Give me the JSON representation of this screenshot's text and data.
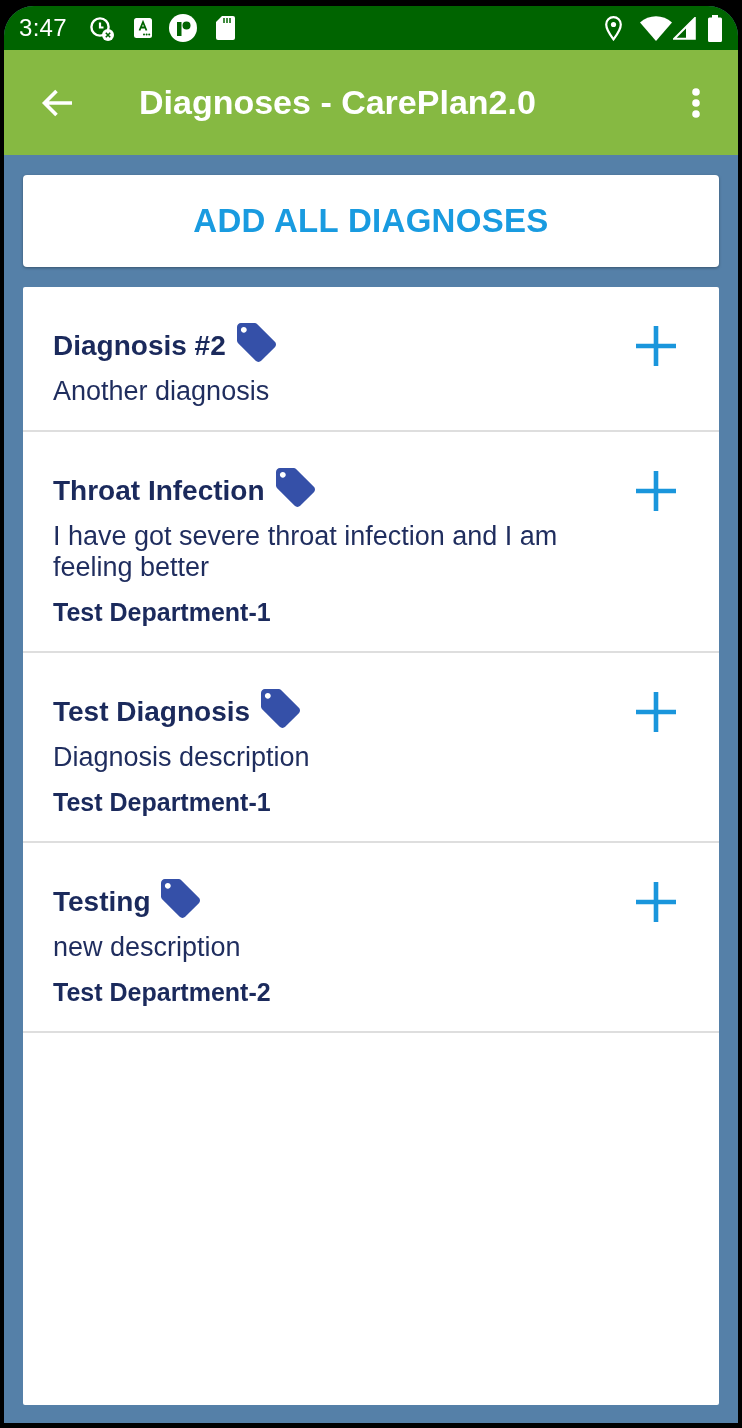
{
  "status_bar": {
    "time": "3:47"
  },
  "app_bar": {
    "title": "Diagnoses - CarePlan2.0"
  },
  "add_all_button": {
    "label": "ADD ALL DIAGNOSES"
  },
  "diagnoses": [
    {
      "title": "Diagnosis #2",
      "description": "Another diagnosis"
    },
    {
      "title": "Throat Infection",
      "description": "I have got severe throat infection and I am feeling better",
      "department": "Test Department-1"
    },
    {
      "title": "Test Diagnosis",
      "description": "Diagnosis description",
      "department": "Test Department-1"
    },
    {
      "title": "Testing",
      "description": "new description",
      "department": "Test Department-2"
    }
  ]
}
